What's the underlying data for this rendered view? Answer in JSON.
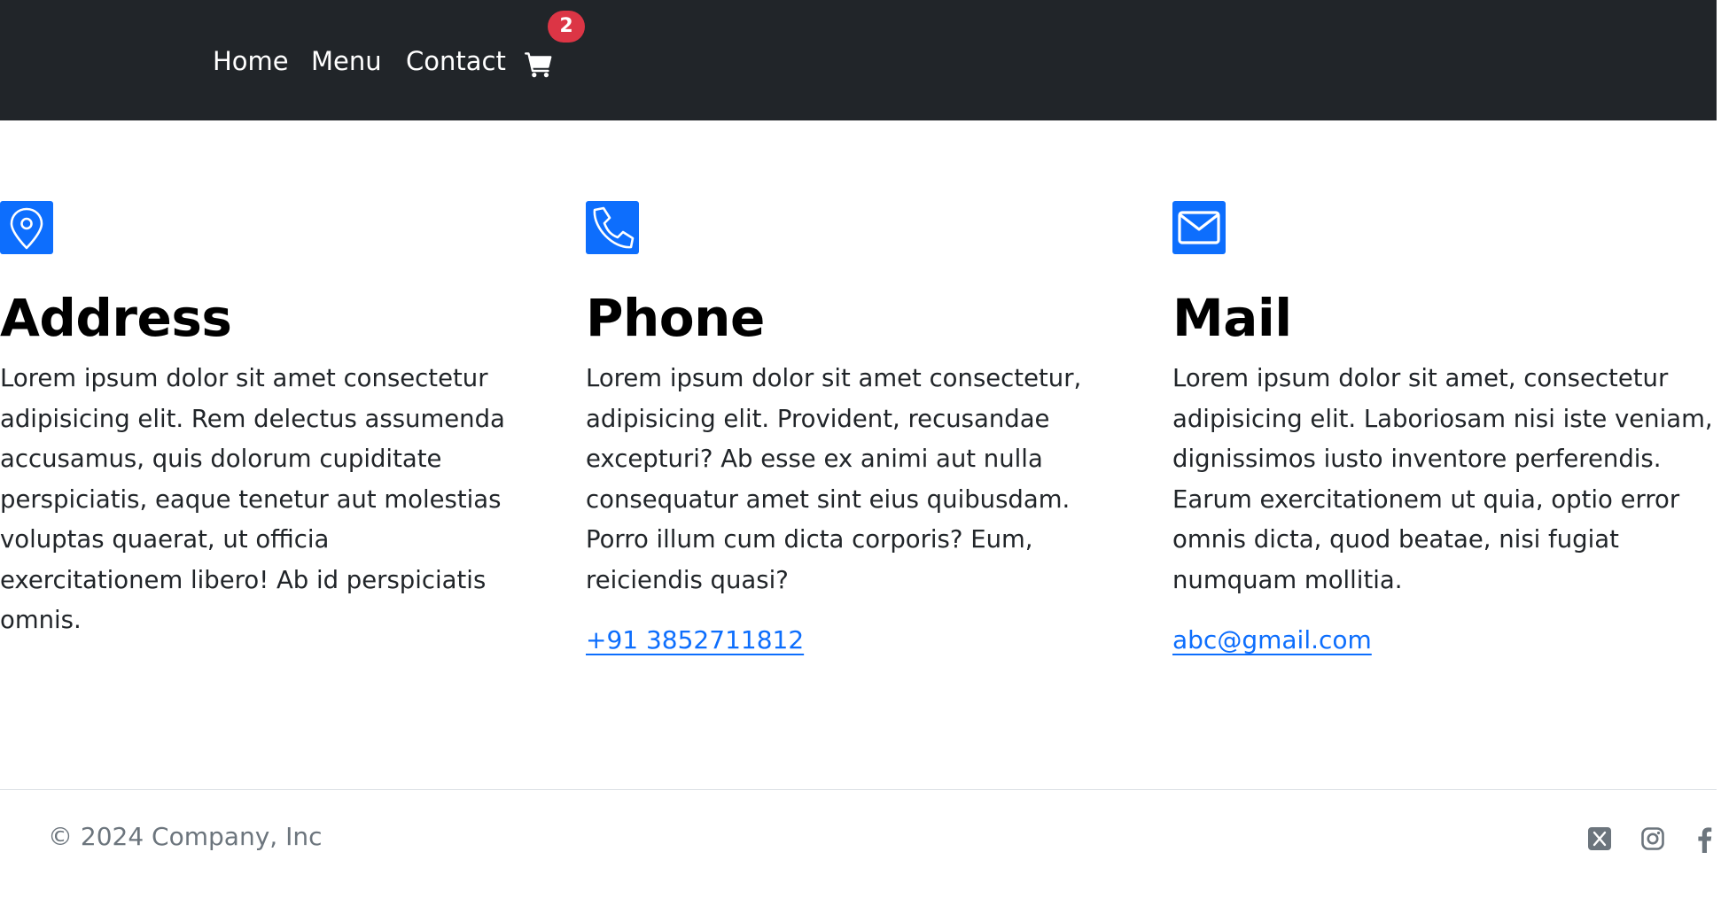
{
  "nav": {
    "items": [
      {
        "label": "Home"
      },
      {
        "label": "Menu"
      },
      {
        "label": "Contact"
      }
    ],
    "cart": {
      "icon": "cart-icon",
      "badge_count": "2"
    }
  },
  "contact": {
    "address": {
      "icon": "map-pin-icon",
      "title": "Address",
      "text": "Lorem ipsum dolor sit amet consectetur adipisicing elit. Rem delectus assumenda accusamus, quis dolorum cupiditate perspiciatis, eaque tenetur aut molestias voluptas quaerat, ut officia exercitationem libero! Ab id perspiciatis omnis."
    },
    "phone": {
      "icon": "phone-icon",
      "title": "Phone",
      "text": "Lorem ipsum dolor sit amet consectetur, adipisicing elit. Provident, recusandae excepturi? Ab esse ex animi aut nulla consequatur amet sint eius quibusdam. Porro illum cum dicta corporis? Eum, reiciendis quasi?",
      "link": "+91 3852711812"
    },
    "mail": {
      "icon": "envelope-icon",
      "title": "Mail",
      "text": "Lorem ipsum dolor sit amet, consectetur adipisicing elit. Laboriosam nisi iste veniam, dignissimos iusto inventore perferendis. Earum exercitationem ut quia, optio error omnis dicta, quod beatae, nisi fugiat numquam mollitia.",
      "link": "abc@gmail.com"
    }
  },
  "footer": {
    "copyright": "© 2024 Company, Inc",
    "social": [
      "x-twitter-icon",
      "instagram-icon",
      "facebook-icon"
    ]
  },
  "colors": {
    "navbar_bg": "#212529",
    "accent": "#0d6efd",
    "badge": "#dc3545",
    "muted": "#6c757d"
  }
}
